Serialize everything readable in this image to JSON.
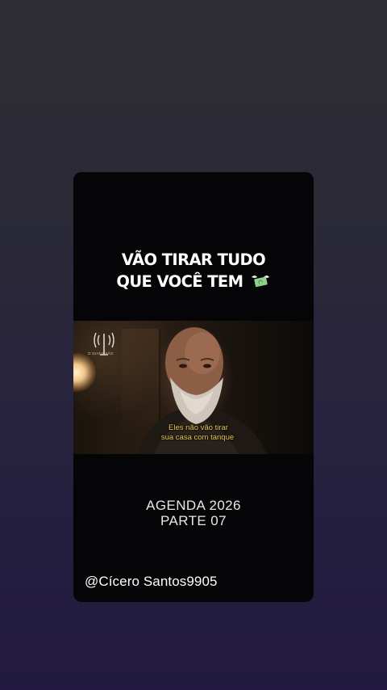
{
  "post": {
    "headline": [
      "VÃO TIRAR TUDO",
      "QUE VOCÊ TEM"
    ],
    "headline_emoji": "money-with-wings-icon",
    "video": {
      "logo_text": "O DIATISSÃO",
      "subtitles": [
        "Eles não vão tirar",
        "sua casa com tanque"
      ]
    },
    "caption": [
      "AGENDA 2026",
      "PARTE 07"
    ],
    "author_handle": "@Cícero Santos9905"
  },
  "colors": {
    "card_background": "#050508",
    "subtitle_color": "#e8c84a",
    "text_color": "#ffffff"
  }
}
